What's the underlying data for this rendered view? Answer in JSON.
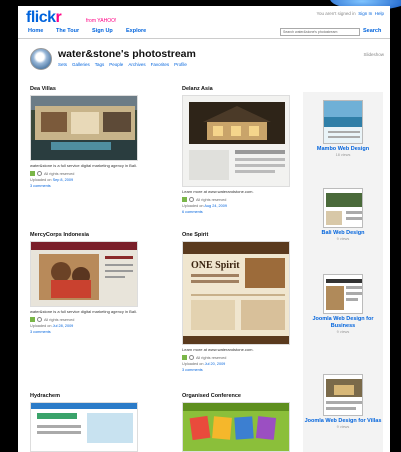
{
  "brand": {
    "logo_f": "flick",
    "logo_r": "r",
    "sub": "from YAHOO!"
  },
  "topbar": {
    "signin_text": "You aren't signed in",
    "signin_link": "Sign In",
    "help": "Help"
  },
  "nav": {
    "items": [
      "Home",
      "The Tour",
      "Sign Up",
      "Explore"
    ],
    "search_placeholder": "Search water&stone's photostream",
    "search_label": "Search"
  },
  "header": {
    "title": "water&stone's photostream",
    "subnav": [
      "Sets",
      "Galleries",
      "Tags",
      "People",
      "Archives",
      "Favorites",
      "Profile"
    ],
    "slideshow": "Slideshow"
  },
  "cards": [
    {
      "title": "Dea Villas",
      "caption": "water&stone is a full service digital marketing agency in Bali.",
      "rights": "All rights reserved",
      "uploaded_prefix": "Uploaded on",
      "uploaded_date": "Sep 8, 2009",
      "comments": "3 comments"
    },
    {
      "title": "Delanz Asia",
      "caption": "Learn more at www.waterandstone.com.",
      "rights": "All rights reserved",
      "uploaded_prefix": "Uploaded on",
      "uploaded_date": "Aug 24, 2009",
      "comments": "6 comments"
    },
    {
      "title": "MercyCorps Indonesia",
      "caption": "water&stone is a full service digital marketing agency in Bali.",
      "rights": "All rights reserved",
      "uploaded_prefix": "Uploaded on",
      "uploaded_date": "Jul 28, 2009",
      "comments": "3 comments"
    },
    {
      "title": "One Spirit",
      "caption": "Learn more at www.waterandstone.com.",
      "rights": "All rights reserved",
      "uploaded_prefix": "Uploaded on",
      "uploaded_date": "Jul 20, 2009",
      "comments": "3 comments"
    },
    {
      "title": "Hydrachem"
    },
    {
      "title": "Organised Conference"
    }
  ],
  "photo_texts": {
    "one_spirit": "ONE Spirit"
  },
  "sidebar": [
    {
      "label": "Mambo Web Design",
      "views": "18 views"
    },
    {
      "label": "Bali Web Design",
      "views": "9 views"
    },
    {
      "label": "Joomla Web Design for Business",
      "views": "9 views"
    },
    {
      "label": "Joomla Web Design for Villas",
      "views": "9 views"
    }
  ]
}
